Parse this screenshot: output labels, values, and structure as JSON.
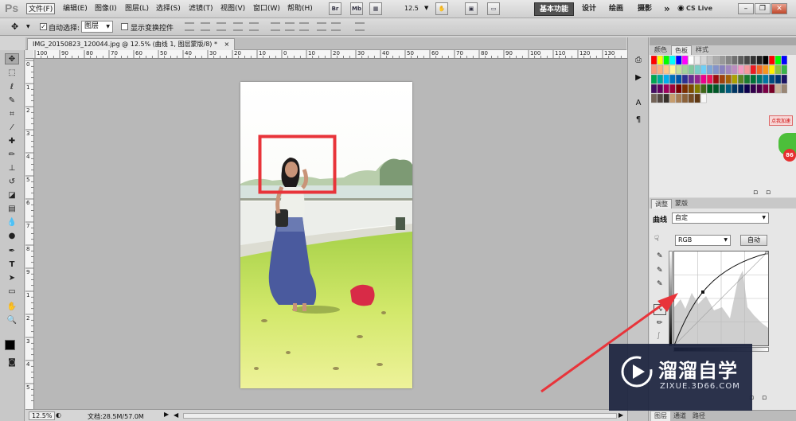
{
  "app": {
    "logo": "Ps"
  },
  "menu": [
    "文件(F)",
    "编辑(E)",
    "图像(I)",
    "图层(L)",
    "选择(S)",
    "滤镜(T)",
    "视图(V)",
    "窗口(W)",
    "帮助(H)"
  ],
  "menubar_icons": [
    "Br",
    "Mb"
  ],
  "zoom_level": "12.5",
  "workspaces": [
    "基本功能",
    "设计",
    "绘画",
    "摄影"
  ],
  "more_label": "»",
  "cs_live": "CS Live",
  "window_controls": {
    "minimize": "–",
    "restore": "❐",
    "close": "✕"
  },
  "options": {
    "auto_select_label": "自动选择:",
    "auto_select_checked": true,
    "layer_select_value": "图层",
    "show_transform_label": "显示变换控件"
  },
  "doc_tab": {
    "title": "IMG_20150823_120044.jpg @ 12.5% (曲线 1, 图层蒙版/8) *",
    "close": "×"
  },
  "ruler_h": [
    "100",
    "90",
    "80",
    "70",
    "60",
    "50",
    "40",
    "30",
    "20",
    "10",
    "0",
    "10",
    "20",
    "30",
    "40",
    "50",
    "60",
    "70",
    "80",
    "90",
    "100",
    "110",
    "120",
    "130"
  ],
  "ruler_v": [
    "0",
    "1",
    "2",
    "3",
    "4",
    "5",
    "6",
    "7",
    "8",
    "9",
    "1",
    "2",
    "3",
    "4",
    "5"
  ],
  "status": {
    "zoom": "12.5%",
    "doc_info": "文档:28.5M/57.0M"
  },
  "swatches_tabs": [
    "颜色",
    "色板",
    "样式"
  ],
  "adjust_tabs": [
    "调整",
    "蒙版"
  ],
  "curves": {
    "label": "曲线",
    "preset": "自定",
    "channel": "RGB",
    "auto_label": "自动"
  },
  "bottom_tabs": [
    "图层",
    "通道",
    "路径"
  ],
  "promo": {
    "text": "点我加速",
    "number": "86"
  },
  "watermark": {
    "title": "溜溜自学",
    "url": "ZIXUE.3D66.COM"
  },
  "colors": {
    "highlight_box": "#e8343a",
    "arrow": "#e8343a",
    "watermark_bg": "#1b233e"
  }
}
